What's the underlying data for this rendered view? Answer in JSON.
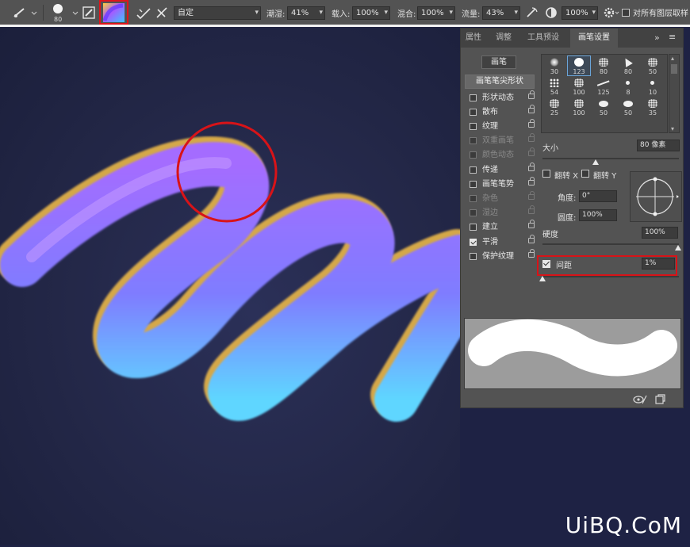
{
  "options_bar": {
    "brush_size": "80",
    "mode_value": "自定",
    "wetness_label": "潮湿:",
    "wetness_value": "41%",
    "load_label": "载入:",
    "load_value": "100%",
    "mix_label": "混合:",
    "mix_value": "100%",
    "flow_label": "流量:",
    "flow_value": "43%",
    "angle_value": "100%",
    "sample_all_layers_label": "对所有图层取样"
  },
  "panel": {
    "tabs": [
      "属性",
      "调整",
      "工具预设",
      "画笔设置"
    ],
    "active_tab_index": 3,
    "brush_presets_button": "画笔",
    "tip_shape_label": "画笔笔尖形状",
    "options": [
      {
        "label": "形状动态",
        "checked": false,
        "disabled": false
      },
      {
        "label": "散布",
        "checked": false,
        "disabled": false
      },
      {
        "label": "纹理",
        "checked": false,
        "disabled": false
      },
      {
        "label": "双重画笔",
        "checked": false,
        "disabled": true
      },
      {
        "label": "颜色动态",
        "checked": false,
        "disabled": true
      },
      {
        "label": "传递",
        "checked": false,
        "disabled": false
      },
      {
        "label": "画笔笔势",
        "checked": false,
        "disabled": false
      },
      {
        "label": "杂色",
        "checked": false,
        "disabled": true
      },
      {
        "label": "湿边",
        "checked": false,
        "disabled": true
      },
      {
        "label": "建立",
        "checked": false,
        "disabled": false
      },
      {
        "label": "平滑",
        "checked": true,
        "disabled": false
      },
      {
        "label": "保护纹理",
        "checked": false,
        "disabled": false
      }
    ],
    "brush_sizes": [
      "30",
      "123",
      "80",
      "80",
      "50",
      "54",
      "100",
      "125",
      "8",
      "10",
      "25",
      "100",
      "50",
      "50",
      "35"
    ],
    "selected_brush_index": 1,
    "size_label": "大小",
    "size_value": "80 像素",
    "flip_x_label": "翻转 X",
    "flip_y_label": "翻转 Y",
    "angle_label": "角度:",
    "angle_value": "0°",
    "roundness_label": "圆度:",
    "roundness_value": "100%",
    "hardness_label": "硬度",
    "hardness_value": "100%",
    "spacing_label": "间距",
    "spacing_checked": true,
    "spacing_value": "1%"
  },
  "watermark": "UiBQ.CoM",
  "colors": {
    "highlight_red": "#e0141b",
    "stroke_purple": "#9a6bff",
    "stroke_cyan": "#5fd3ff",
    "stroke_gold": "#e8b64a"
  }
}
